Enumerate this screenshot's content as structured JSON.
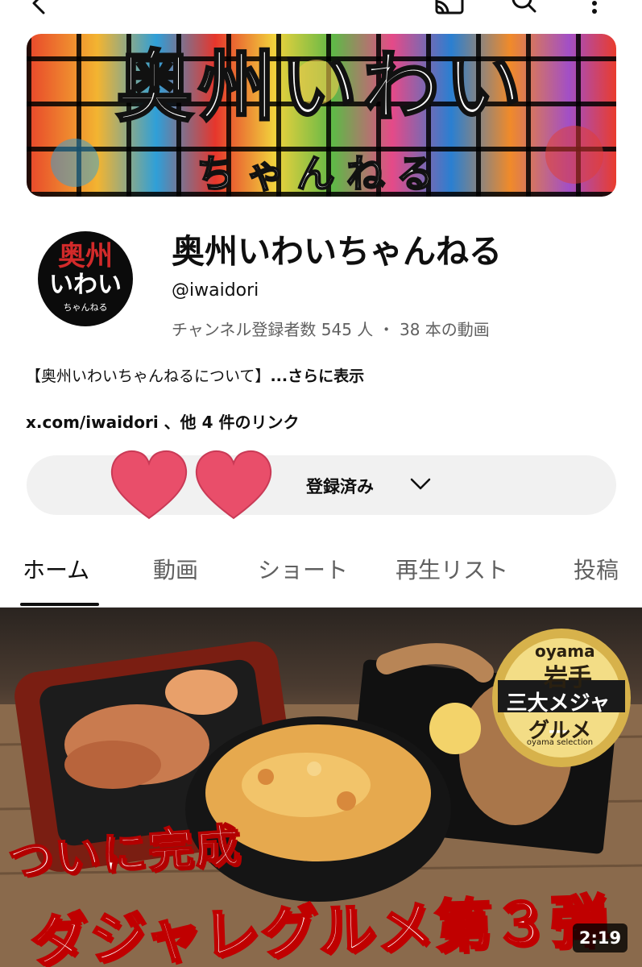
{
  "topbar": {
    "icons": [
      "back-icon",
      "cast-icon",
      "search-icon",
      "more-vert-icon"
    ]
  },
  "banner": {
    "title": "奥州いわい",
    "subtitle": "ちゃんねる"
  },
  "avatar": {
    "line1": "奥州",
    "line2": "いわい",
    "line3": "ちゃんねる"
  },
  "channel": {
    "name": "奥州いわいちゃんねる",
    "handle": "@iwaidori",
    "stats": "チャンネル登録者数 545 人 ・ 38 本の動画"
  },
  "about": {
    "text": "【奥州いわいちゃんねるについて】",
    "more": "...さらに表示"
  },
  "links": {
    "text": "x.com/iwaidori 、他 4 件のリンク"
  },
  "subscribe": {
    "label": "登録済み",
    "icons": [
      "heart-icon",
      "heart-icon",
      "chevron-down-icon"
    ]
  },
  "tabs": [
    {
      "label": "ホーム",
      "active": true
    },
    {
      "label": "動画",
      "active": false
    },
    {
      "label": "ショート",
      "active": false
    },
    {
      "label": "再生リスト",
      "active": false
    },
    {
      "label": "投稿",
      "active": false
    }
  ],
  "video": {
    "badge": {
      "top": "oyama",
      "line1": "岩手",
      "line2": "三大メジャー",
      "line3": "グルメ",
      "line4": "oyama selection"
    },
    "caption1": "ついに完成",
    "caption2": "ダジャレグルメ第３弾",
    "duration": "2:19"
  },
  "colors": {
    "text_primary": "#0f0f0f",
    "text_secondary": "#606060",
    "button_bg": "#f1f1f1",
    "heart": "#e94e6a"
  }
}
